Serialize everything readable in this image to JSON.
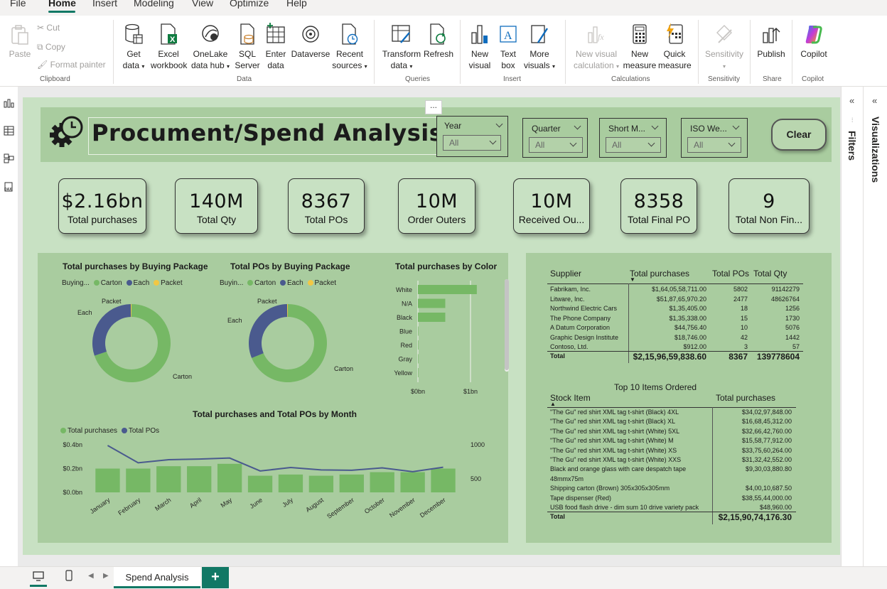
{
  "menu": [
    "File",
    "Home",
    "Insert",
    "Modeling",
    "View",
    "Optimize",
    "Help"
  ],
  "ribbon": {
    "clipboard": {
      "paste": "Paste",
      "cut": "Cut",
      "copy": "Copy",
      "format_painter": "Format painter",
      "group": "Clipboard"
    },
    "data": {
      "get_data": [
        "Get",
        "data"
      ],
      "excel": [
        "Excel",
        "workbook"
      ],
      "onelake": [
        "OneLake",
        "data hub"
      ],
      "sql": [
        "SQL",
        "Server"
      ],
      "enter": [
        "Enter",
        "data"
      ],
      "dataverse": "Dataverse",
      "recent": [
        "Recent",
        "sources"
      ],
      "group": "Data"
    },
    "queries": {
      "transform": [
        "Transform",
        "data"
      ],
      "refresh": "Refresh",
      "group": "Queries"
    },
    "insert": {
      "new_visual": [
        "New",
        "visual"
      ],
      "text_box": [
        "Text",
        "box"
      ],
      "more_visuals": [
        "More",
        "visuals"
      ],
      "group": "Insert"
    },
    "calculations": {
      "new_visual_calc": [
        "New visual",
        "calculation"
      ],
      "new_measure": [
        "New",
        "measure"
      ],
      "quick_measure": [
        "Quick",
        "measure"
      ],
      "group": "Calculations"
    },
    "sensitivity": {
      "label": "Sensitivity",
      "group": "Sensitivity"
    },
    "share": {
      "publish": "Publish",
      "group": "Share"
    },
    "copilot": {
      "label": "Copilot",
      "group": "Copilot"
    }
  },
  "report": {
    "title": "Procument/Spend Analysis",
    "more_options": "...",
    "slicers": [
      {
        "title": "Year",
        "value": "All"
      },
      {
        "title": "Quarter",
        "value": "All"
      },
      {
        "title": "Short M...",
        "value": "All"
      },
      {
        "title": "ISO We...",
        "value": "All"
      }
    ],
    "clear_label": "Clear",
    "kpis": [
      {
        "value": "$2.16bn",
        "label": "Total purchases"
      },
      {
        "value": "140M",
        "label": "Total Qty"
      },
      {
        "value": "8367",
        "label": "Total POs"
      },
      {
        "value": "10M",
        "label": "Order Outers"
      },
      {
        "value": "10M",
        "label": "Received Ou..."
      },
      {
        "value": "8358",
        "label": "Total Final PO"
      },
      {
        "value": "9",
        "label": "Total Non Fin..."
      }
    ]
  },
  "chart_data": [
    {
      "type": "pie",
      "title": "Total purchases by Buying Package",
      "legend_title": "Buying...",
      "categories": [
        "Carton",
        "Each",
        "Packet"
      ],
      "values": [
        70,
        30,
        0.3
      ],
      "colors": [
        "#76b865",
        "#4a5a8e",
        "#f2c744"
      ]
    },
    {
      "type": "pie",
      "title": "Total POs by Buying Package",
      "legend_title": "Buyin...",
      "categories": [
        "Carton",
        "Each",
        "Packet"
      ],
      "values": [
        69,
        31,
        0.3
      ],
      "colors": [
        "#76b865",
        "#4a5a8e",
        "#f2c744"
      ]
    },
    {
      "type": "bar",
      "orientation": "horizontal",
      "title": "Total purchases by Color",
      "categories": [
        "White",
        "N/A",
        "Black",
        "Blue",
        "Red",
        "Gray",
        "Yellow"
      ],
      "values": [
        1.12,
        0.52,
        0.52,
        0.005,
        0.004,
        0.003,
        0.002
      ],
      "xticks": [
        "$0bn",
        "$1bn"
      ],
      "xlim": [
        0,
        1.2
      ],
      "color": "#76b865"
    },
    {
      "type": "bar",
      "title": "Total purchases and Total POs by Month",
      "categories": [
        "January",
        "February",
        "March",
        "April",
        "May",
        "June",
        "July",
        "August",
        "September",
        "October",
        "November",
        "December"
      ],
      "series": [
        {
          "name": "Total purchases",
          "values": [
            0.2,
            0.2,
            0.22,
            0.22,
            0.24,
            0.14,
            0.15,
            0.14,
            0.15,
            0.17,
            0.17,
            0.2
          ],
          "color": "#76b865",
          "type": "bar"
        },
        {
          "name": "Total POs",
          "values": [
            990,
            735,
            780,
            790,
            805,
            615,
            665,
            630,
            625,
            660,
            605,
            670
          ],
          "color": "#4a5a8e",
          "type": "line"
        }
      ],
      "ylim": [
        0,
        0.4
      ],
      "yticks": [
        "$0.0bn",
        "$0.2bn",
        "$0.4bn"
      ],
      "y2lim": [
        300,
        1000
      ],
      "y2ticks": [
        "500",
        "1000"
      ]
    }
  ],
  "supplier_table": {
    "headers": [
      "Supplier",
      "Total purchases",
      "Total POs",
      "Total Qty"
    ],
    "rows": [
      [
        "Fabrikam, Inc.",
        "$1,64,05,58,711.00",
        "5802",
        "91142279"
      ],
      [
        "Litware, Inc.",
        "$51,87,65,970.20",
        "2477",
        "48626764"
      ],
      [
        "Northwind Electric Cars",
        "$1,35,405.00",
        "18",
        "1256"
      ],
      [
        "The Phone Company",
        "$1,35,338.00",
        "15",
        "1730"
      ],
      [
        "A Datum Corporation",
        "$44,756.40",
        "10",
        "5076"
      ],
      [
        "Graphic Design Institute",
        "$18,746.00",
        "42",
        "1442"
      ],
      [
        "Contoso, Ltd.",
        "$912.00",
        "3",
        "57"
      ]
    ],
    "total": [
      "Total",
      "$2,15,96,59,838.60",
      "8367",
      "139778604"
    ]
  },
  "top_items_table": {
    "title": "Top 10 Items Ordered",
    "headers": [
      "Stock Item",
      "Total purchases"
    ],
    "rows": [
      [
        "\"The Gu\" red shirt XML tag t-shirt (Black) 4XL",
        "$34,02,97,848.00"
      ],
      [
        "\"The Gu\" red shirt XML tag t-shirt (Black) XL",
        "$16,68,45,312.00"
      ],
      [
        "\"The Gu\" red shirt XML tag t-shirt (White) 5XL",
        "$32,66,42,760.00"
      ],
      [
        "\"The Gu\" red shirt XML tag t-shirt (White) M",
        "$15,58,77,912.00"
      ],
      [
        "\"The Gu\" red shirt XML tag t-shirt (White) XS",
        "$33,75,60,264.00"
      ],
      [
        "\"The Gu\" red shirt XML tag t-shirt (White) XXS",
        "$31,32,42,552.00"
      ],
      [
        "Black and orange glass with care despatch tape",
        "$9,30,03,880.80"
      ],
      [
        "48mmx75m",
        ""
      ],
      [
        "Shipping carton (Brown) 305x305x305mm",
        "$4,00,10,687.50"
      ],
      [
        "Tape dispenser (Red)",
        "$38,55,44,000.00"
      ],
      [
        "USB food flash drive - dim sum 10 drive variety pack",
        "$48,960.00"
      ]
    ],
    "total": [
      "Total",
      "$2,15,90,74,176.30"
    ]
  },
  "panes": {
    "filters": "Filters",
    "visualizations": "Visualizations"
  },
  "bottom": {
    "tab": "Spend Analysis",
    "add": "+"
  }
}
